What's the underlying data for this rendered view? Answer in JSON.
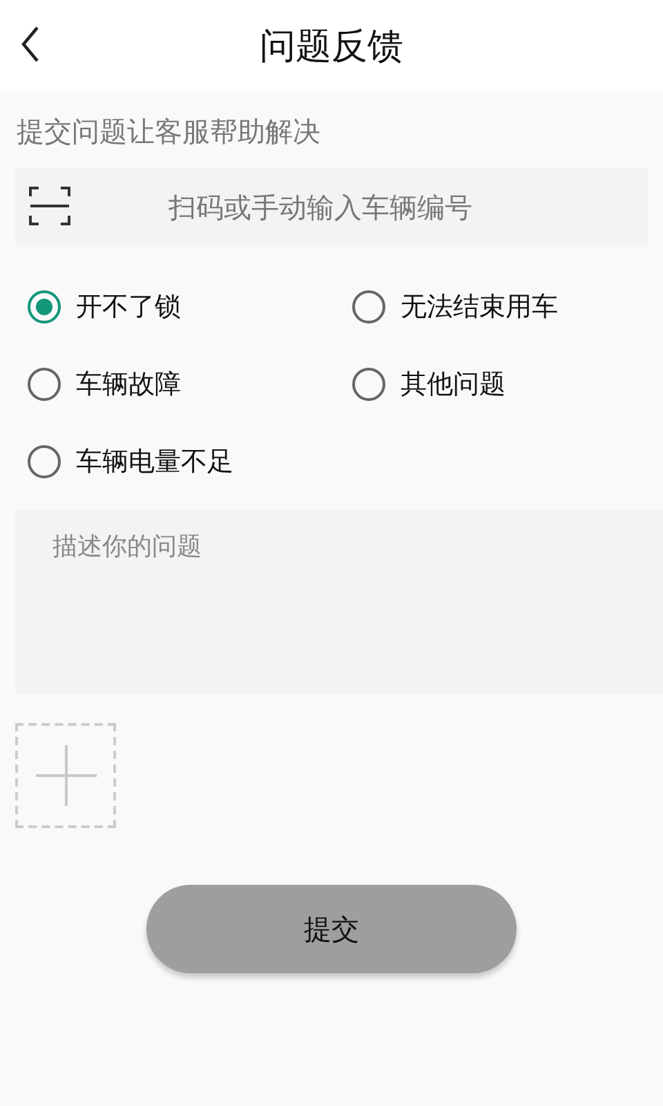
{
  "header": {
    "title": "问题反馈"
  },
  "subtitle": "提交问题让客服帮助解决",
  "vehicle_field": {
    "placeholder": "扫码或手动输入车辆编号"
  },
  "issue_options": [
    {
      "label": "开不了锁",
      "selected": true
    },
    {
      "label": "无法结束用车",
      "selected": false
    },
    {
      "label": "车辆故障",
      "selected": false
    },
    {
      "label": "其他问题",
      "selected": false
    },
    {
      "label": "车辆电量不足",
      "selected": false
    }
  ],
  "description_field": {
    "placeholder": "描述你的问题"
  },
  "submit_button": "提交"
}
